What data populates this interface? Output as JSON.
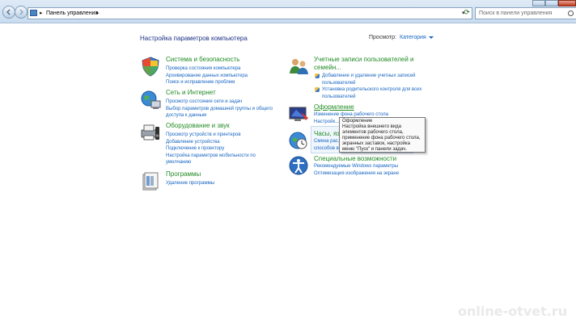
{
  "address_bar": {
    "path": "Панель управления"
  },
  "search": {
    "placeholder": "Поиск в панели управления"
  },
  "page": {
    "title": "Настройка параметров компьютера",
    "view_label": "Просмотр:",
    "view_value": "Категория"
  },
  "left_categories": [
    {
      "title": "Система и безопасность",
      "icon": "system-security-icon",
      "links": [
        "Проверка состояния компьютера",
        "Архивирование данных компьютера",
        "Поиск и исправление проблем"
      ]
    },
    {
      "title": "Сеть и Интернет",
      "icon": "network-icon",
      "links": [
        "Просмотр состояния сети и задач",
        "Выбор параметров домашней группы и общего",
        "доступа к данным"
      ]
    },
    {
      "title": "Оборудование и звук",
      "icon": "hardware-sound-icon",
      "links": [
        "Просмотр устройств и принтеров",
        "Добавление устройства",
        "Подключение к проектору",
        "Настройка параметров мобильности по",
        "умолчанию"
      ]
    },
    {
      "title": "Программы",
      "icon": "programs-icon",
      "links": [
        "Удаление программы"
      ]
    }
  ],
  "right_categories": [
    {
      "title": "Учетные записи пользователей и",
      "title2": "семейн...",
      "icon": "user-accounts-icon",
      "links": [
        "Добавление и удаление учетных записей",
        "пользователей",
        "Установка родительского контроля для всех",
        "пользователей"
      ]
    },
    {
      "title": "Оформление",
      "icon": "appearance-icon",
      "links": [
        "Изменение фона рабочего стола",
        "Настройк..."
      ]
    },
    {
      "title": "Часы, яз...",
      "icon": "clock-language-icon",
      "links": [
        "Смена рас...",
        "способов в..."
      ]
    },
    {
      "title": "Специальные возможности",
      "icon": "accessibility-icon",
      "links": [
        "Рекомендуемые Windows параметры",
        "Оптимизация изображения на экране"
      ]
    }
  ],
  "tooltip": {
    "lines": [
      "Оформление",
      "Настройка внешнего вида",
      "элементов рабочего стола,",
      "применение фона рабочего стола,",
      "экранных заставок, настройка",
      "меню \"Пуск\" и панели задач."
    ]
  },
  "watermark": "online-otvet.ru"
}
